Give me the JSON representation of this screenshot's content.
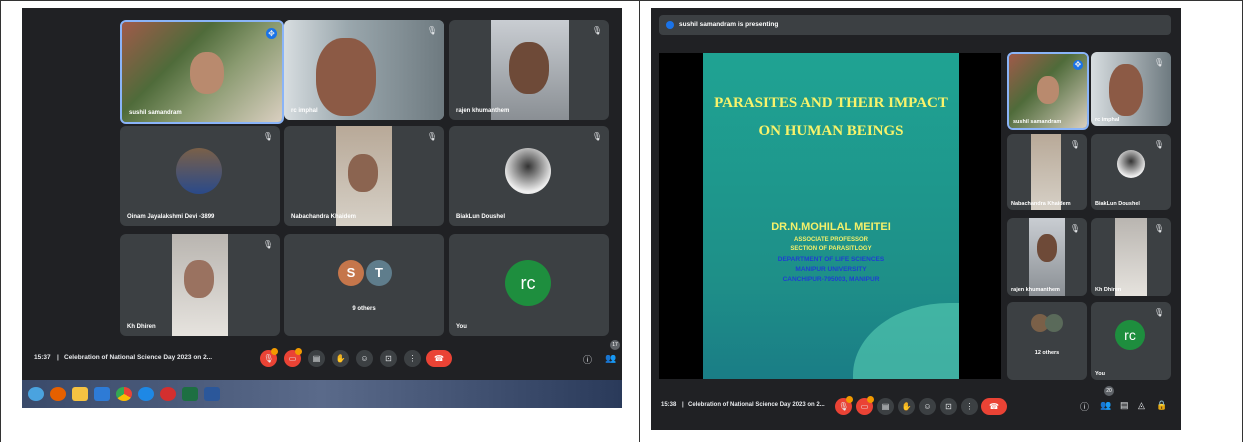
{
  "left": {
    "tiles": [
      {
        "name": "sushil samandram"
      },
      {
        "name": "rc imphal"
      },
      {
        "name": "rajen khumanthem"
      },
      {
        "name": "Oinam Jayalakshmi Devi -3899"
      },
      {
        "name": "Nabachandra Khaidem"
      },
      {
        "name": "BiakLun Doushel"
      },
      {
        "name": "Kh Dhiren"
      },
      {
        "name": "9 others",
        "avatars": [
          "S",
          "T"
        ]
      },
      {
        "name": "You",
        "avatar": "rc"
      }
    ],
    "bar": {
      "time": "15:37",
      "title": "Celebration of National Science Day 2023 on 2...",
      "participants": "17"
    }
  },
  "right": {
    "presenting": "sushil samandram is presenting",
    "slide": {
      "title_line1": "PARASITES AND THEIR IMPACT",
      "title_line2": "ON HUMAN BEINGS",
      "presenter": "DR.N.MOHILAL MEITEI",
      "lines": [
        "ASSOCIATE PROFESSOR",
        "SECTION OF PARASITLOGY",
        "DEPARTMENT OF LIFE SCIENCES",
        "MANIPUR UNIVERSITY",
        "CANCHIPUR-795003, MANIPUR"
      ]
    },
    "tiles": [
      {
        "name": "sushil samandram"
      },
      {
        "name": "rc imphal"
      },
      {
        "name": "Nabachandra Khaidem"
      },
      {
        "name": "BiakLun Doushel"
      },
      {
        "name": "rajen khumanthem"
      },
      {
        "name": "Kh Dhiren"
      },
      {
        "name": "12 others"
      },
      {
        "name": "You",
        "avatar": "rc"
      }
    ],
    "bar": {
      "time": "15:38",
      "title": "Celebration of National Science Day 2023 on 2...",
      "participants": "20"
    }
  },
  "colors": {
    "meet_bg": "#202124",
    "tile": "#3c4043",
    "end_call": "#ea4335",
    "avatar_green": "#1e8e3e",
    "slide_bg": "#1f9a8f"
  }
}
